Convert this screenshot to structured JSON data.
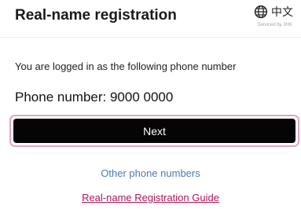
{
  "header": {
    "title": "Real-name registration",
    "language_label": "中文",
    "serviced_by": "Serviced by 3HK"
  },
  "main": {
    "info_text": "You are logged in as the following phone number",
    "phone_label": "Phone number: 9000 0000",
    "next_button": "Next",
    "other_numbers_link": "Other phone numbers",
    "guide_link": "Real-name Registration Guide"
  },
  "colors": {
    "button_bg": "#050505",
    "button_border": "#e0a5c3",
    "link_blue": "#4a7bb5",
    "link_magenta": "#b0155a"
  },
  "icons": {
    "language": "globe-icon"
  }
}
